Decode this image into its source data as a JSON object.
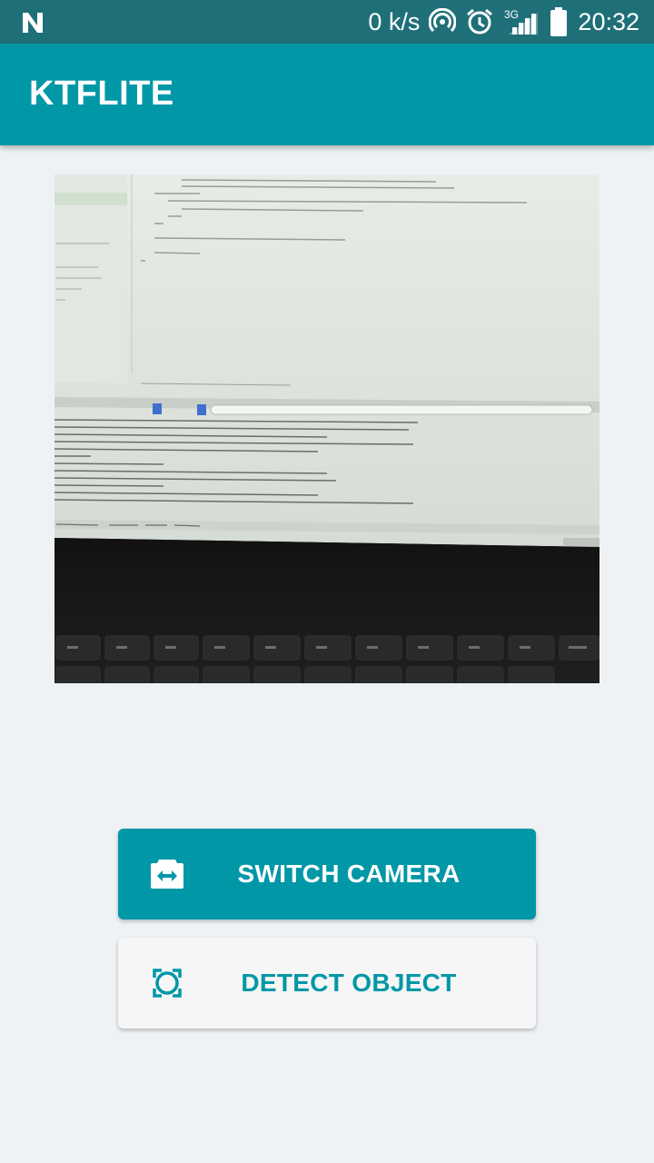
{
  "status_bar": {
    "net_speed": "0 k/s",
    "network_type": "3G",
    "time": "20:32"
  },
  "app_bar": {
    "title": "KTFLITE"
  },
  "buttons": {
    "switch_camera": "SWITCH CAMERA",
    "detect_object": "DETECT OBJECT"
  },
  "icons": {
    "switch_camera": "switch-camera-icon",
    "detect_object": "focus-frame-icon"
  },
  "colors": {
    "status_bar": "#1f6f78",
    "primary": "#0097a7",
    "background": "#eef2f5",
    "secondary_button": "#f6f6f6"
  }
}
